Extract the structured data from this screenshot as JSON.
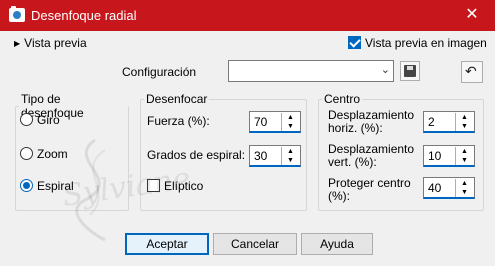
{
  "window": {
    "title": "Desenfoque radial",
    "close_glyph": "✕"
  },
  "preview": {
    "toggle_label": "Vista previa",
    "image_preview_label": "Vista previa en imagen",
    "image_preview_checked": true
  },
  "config": {
    "label": "Configuración",
    "value": ""
  },
  "tipo": {
    "legend": "Tipo de desenfoque",
    "options": [
      {
        "label": "Giro",
        "selected": false
      },
      {
        "label": "Zoom",
        "selected": false
      },
      {
        "label": "Espiral",
        "selected": true
      }
    ]
  },
  "desenfocar": {
    "legend": "Desenfocar",
    "fuerza_label": "Fuerza (%):",
    "fuerza_value": "70",
    "grados_label": "Grados de espiral:",
    "grados_value": "30",
    "eliptico_label": "Elíptico",
    "eliptico_checked": false
  },
  "centro": {
    "legend": "Centro",
    "horiz_label_1": "Desplazamiento",
    "horiz_label_2": "horiz. (%):",
    "horiz_value": "2",
    "vert_label_1": "Desplazamiento",
    "vert_label_2": "vert. (%):",
    "vert_value": "10",
    "protect_label_1": "Proteger centro",
    "protect_label_2": "(%):",
    "protect_value": "40"
  },
  "buttons": {
    "accept": "Aceptar",
    "cancel": "Cancelar",
    "help": "Ayuda"
  },
  "watermark": "Sylviane",
  "colors": {
    "titlebar": "#c8161d",
    "accent": "#0067c0"
  },
  "icons": [
    "camera-icon",
    "close-icon",
    "expand-arrow-icon",
    "chevron-down-icon",
    "save-icon",
    "reset-icon"
  ]
}
